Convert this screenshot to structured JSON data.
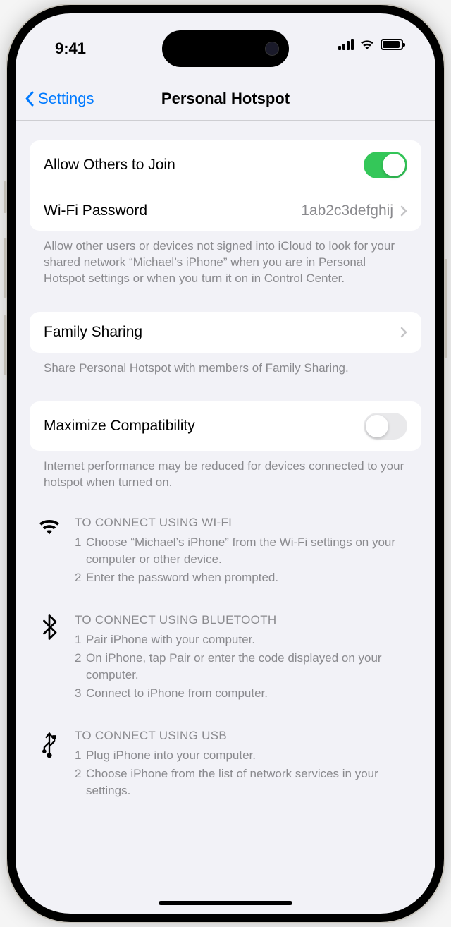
{
  "status": {
    "time": "9:41"
  },
  "nav": {
    "back_label": "Settings",
    "title": "Personal Hotspot"
  },
  "group1": {
    "allow_label": "Allow Others to Join",
    "allow_on": true,
    "pw_label": "Wi-Fi Password",
    "pw_value": "1ab2c3defghij",
    "footer": "Allow other users or devices not signed into iCloud to look for your shared network “Michael’s iPhone” when you are in Personal Hotspot settings or when you turn it on in Control Center."
  },
  "group2": {
    "family_label": "Family Sharing",
    "footer": "Share Personal Hotspot with members of Family Sharing."
  },
  "group3": {
    "compat_label": "Maximize Compatibility",
    "compat_on": false,
    "footer": "Internet performance may be reduced for devices connected to your hotspot when turned on."
  },
  "connect": {
    "wifi": {
      "head": "TO CONNECT USING WI-FI",
      "steps": [
        "Choose “Michael’s iPhone” from the Wi-Fi settings on your computer or other device.",
        "Enter the password when prompted."
      ]
    },
    "bluetooth": {
      "head": "TO CONNECT USING BLUETOOTH",
      "steps": [
        "Pair iPhone with your computer.",
        "On iPhone, tap Pair or enter the code displayed on your computer.",
        "Connect to iPhone from computer."
      ]
    },
    "usb": {
      "head": "TO CONNECT USING USB",
      "steps": [
        "Plug iPhone into your computer.",
        "Choose iPhone from the list of network services in your settings."
      ]
    }
  }
}
